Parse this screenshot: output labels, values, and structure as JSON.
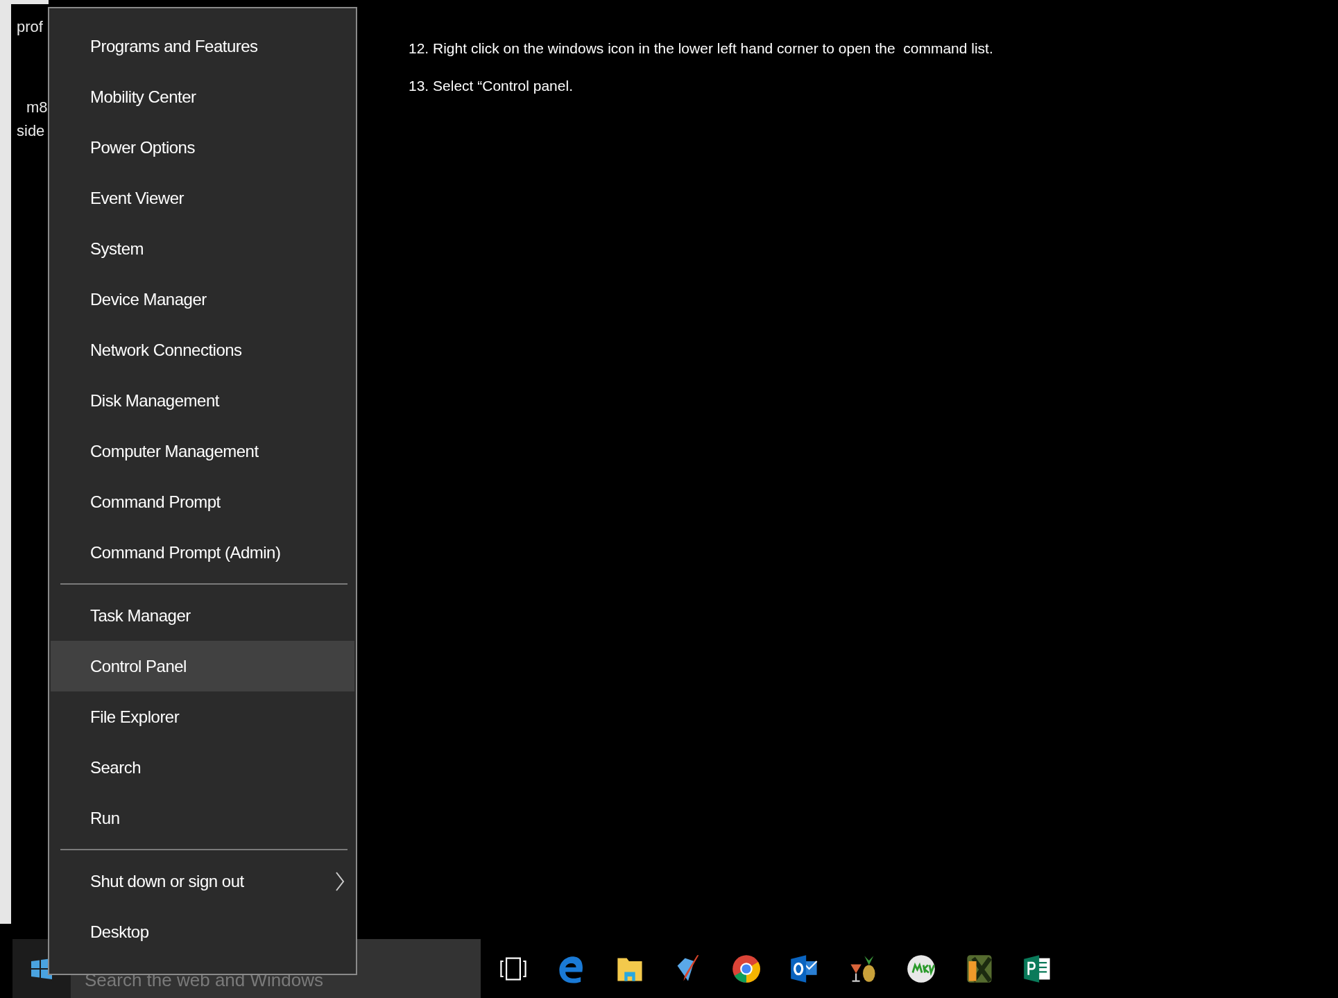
{
  "background_window": {
    "lines": [
      "prof",
      "m8",
      "side"
    ]
  },
  "instructions": [
    "12. Right click on the windows icon in the lower left hand corner to open the  command list.",
    "13. Select “Control panel."
  ],
  "context_menu": {
    "groups": [
      [
        {
          "label": "Programs and Features",
          "selected": false,
          "submenu": false
        },
        {
          "label": "Mobility Center",
          "selected": false,
          "submenu": false
        },
        {
          "label": "Power Options",
          "selected": false,
          "submenu": false
        },
        {
          "label": "Event Viewer",
          "selected": false,
          "submenu": false
        },
        {
          "label": "System",
          "selected": false,
          "submenu": false
        },
        {
          "label": "Device Manager",
          "selected": false,
          "submenu": false
        },
        {
          "label": "Network Connections",
          "selected": false,
          "submenu": false
        },
        {
          "label": "Disk Management",
          "selected": false,
          "submenu": false
        },
        {
          "label": "Computer Management",
          "selected": false,
          "submenu": false
        },
        {
          "label": "Command Prompt",
          "selected": false,
          "submenu": false
        },
        {
          "label": "Command Prompt (Admin)",
          "selected": false,
          "submenu": false
        }
      ],
      [
        {
          "label": "Task Manager",
          "selected": false,
          "submenu": false
        },
        {
          "label": "Control Panel",
          "selected": true,
          "submenu": false
        },
        {
          "label": "File Explorer",
          "selected": false,
          "submenu": false
        },
        {
          "label": "Search",
          "selected": false,
          "submenu": false
        },
        {
          "label": "Run",
          "selected": false,
          "submenu": false
        }
      ],
      [
        {
          "label": "Shut down or sign out",
          "selected": false,
          "submenu": true
        },
        {
          "label": "Desktop",
          "selected": false,
          "submenu": false
        }
      ]
    ]
  },
  "taskbar": {
    "search": {
      "placeholder": "Search the web and Windows"
    }
  }
}
